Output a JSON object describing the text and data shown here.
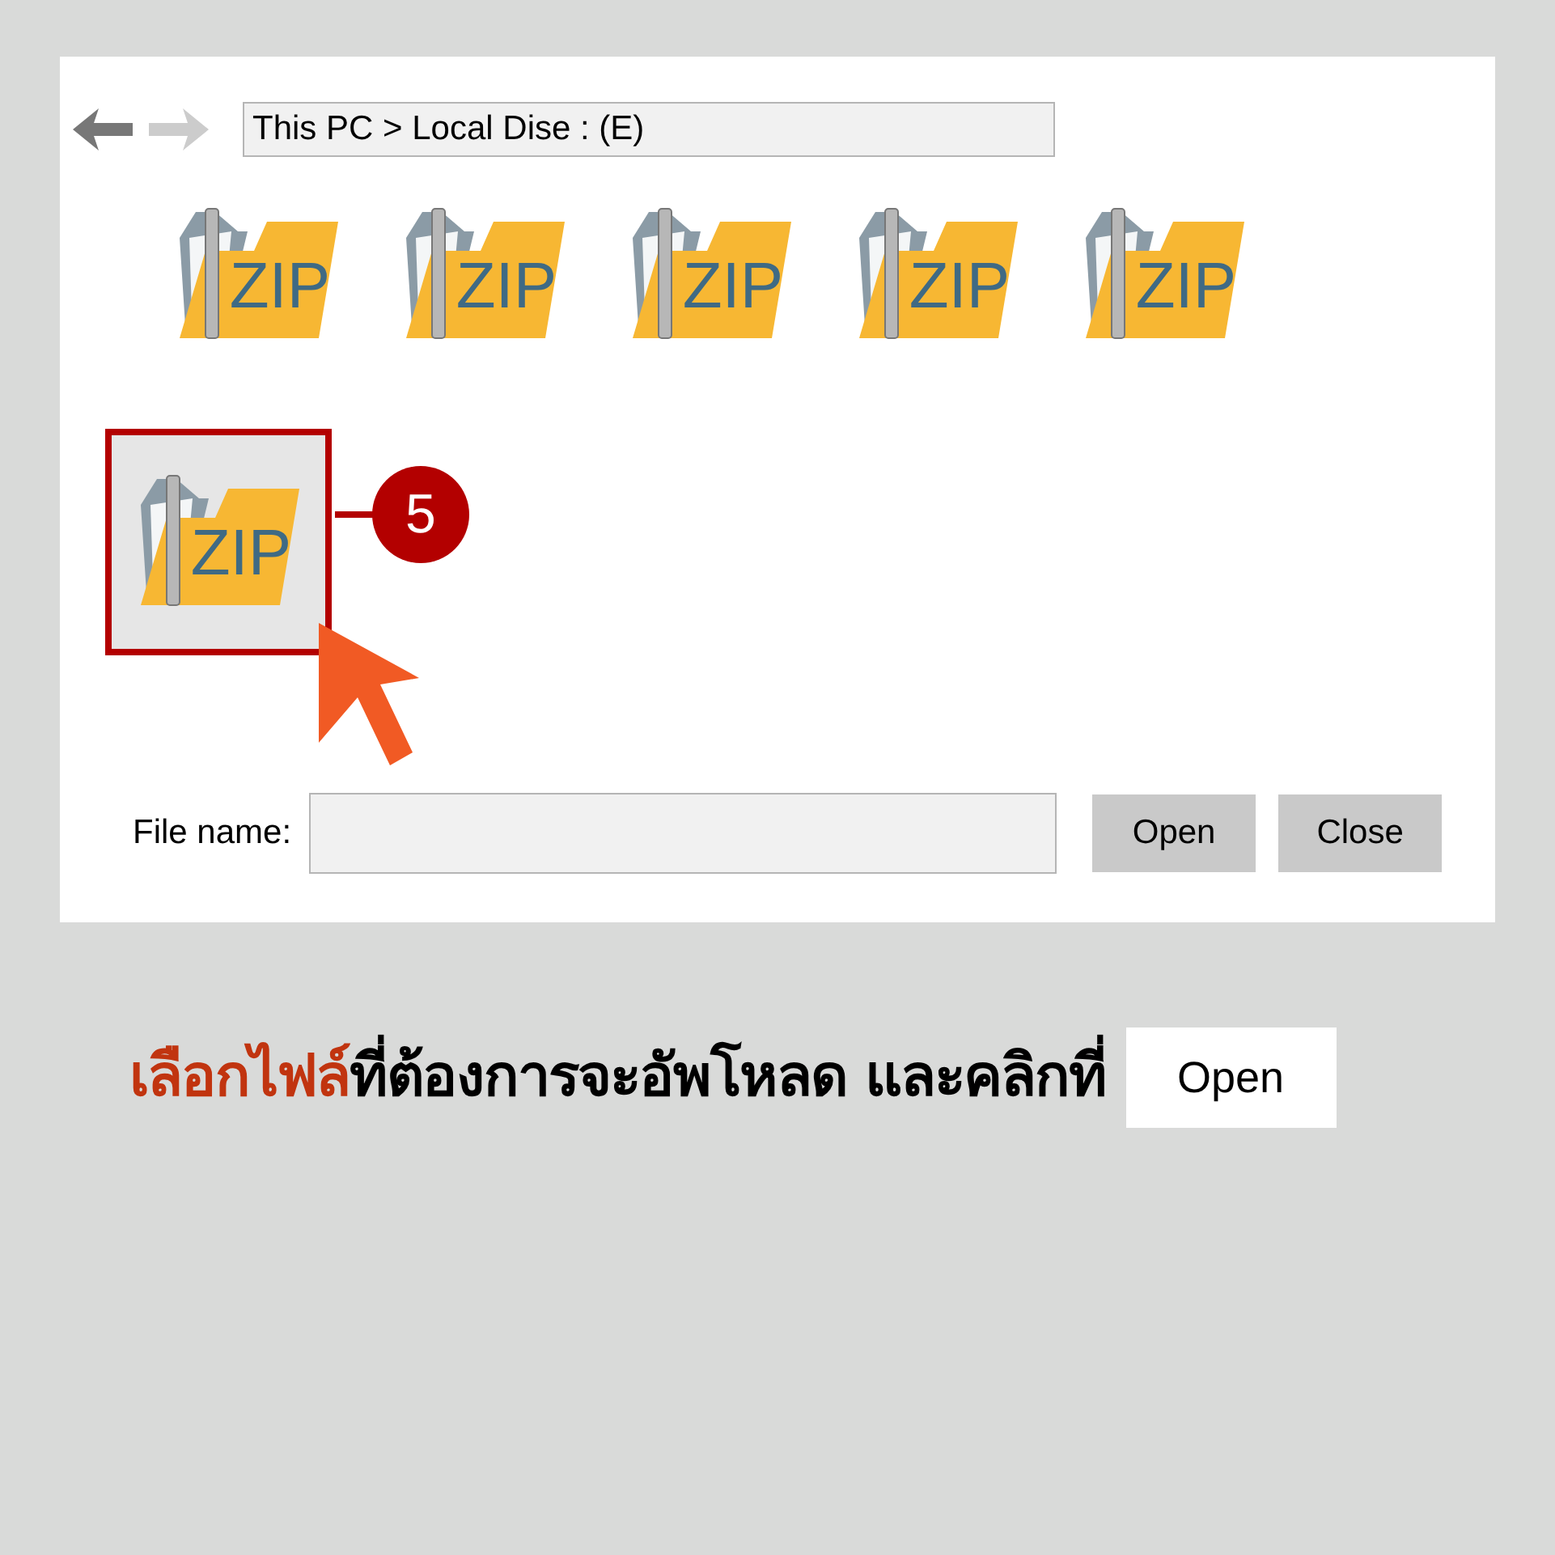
{
  "dialog": {
    "back_enabled": true,
    "forward_enabled": false,
    "path": "This PC > Local Dise : (E)",
    "files": [
      {
        "label": "ZIP",
        "selected": false
      },
      {
        "label": "ZIP",
        "selected": false
      },
      {
        "label": "ZIP",
        "selected": false
      },
      {
        "label": "ZIP",
        "selected": false
      },
      {
        "label": "ZIP",
        "selected": false
      },
      {
        "label": "ZIP",
        "selected": true
      }
    ],
    "step_badge": "5",
    "file_name_label": "File name:",
    "buttons": [
      "Open",
      "Close"
    ]
  },
  "caption": {
    "highlight": "เลือกไฟล์",
    "text": "ที่ต้องการจะอัพโหลด และคลิกที่",
    "button": "Open"
  }
}
